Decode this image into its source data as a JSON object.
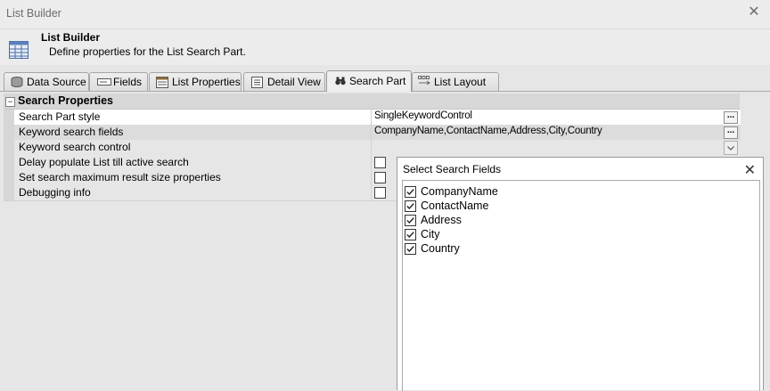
{
  "window": {
    "title": "List Builder"
  },
  "header": {
    "title": "List Builder",
    "description": "Define properties for the List Search Part."
  },
  "tabs": [
    {
      "label": "Data Source",
      "icon": "database-icon"
    },
    {
      "label": "Fields",
      "icon": "fields-icon"
    },
    {
      "label": "List Properties",
      "icon": "list-properties-icon"
    },
    {
      "label": "Detail View",
      "icon": "detail-view-icon"
    },
    {
      "label": "Search Part",
      "icon": "binoculars-icon",
      "active": true
    },
    {
      "label": "List Layout",
      "icon": "list-layout-icon"
    }
  ],
  "grid": {
    "category": "Search Properties",
    "rows": [
      {
        "name": "Search Part style",
        "value": "SingleKeywordControl"
      },
      {
        "name": "Keyword search fields",
        "value": "CompanyName,ContactName,Address,City,Country"
      },
      {
        "name": "Keyword search control",
        "value": ""
      },
      {
        "name": "Delay populate List till active search",
        "checked": false
      },
      {
        "name": "Set search maximum result size properties",
        "checked": false
      },
      {
        "name": "Debugging info",
        "checked": false
      }
    ]
  },
  "dialog": {
    "title": "Select Search Fields",
    "items": [
      {
        "label": "CompanyName",
        "checked": true
      },
      {
        "label": "ContactName",
        "checked": true
      },
      {
        "label": "Address",
        "checked": true
      },
      {
        "label": "City",
        "checked": true
      },
      {
        "label": "Country",
        "checked": true
      }
    ]
  },
  "buttons": {
    "ellipsis": "..."
  }
}
